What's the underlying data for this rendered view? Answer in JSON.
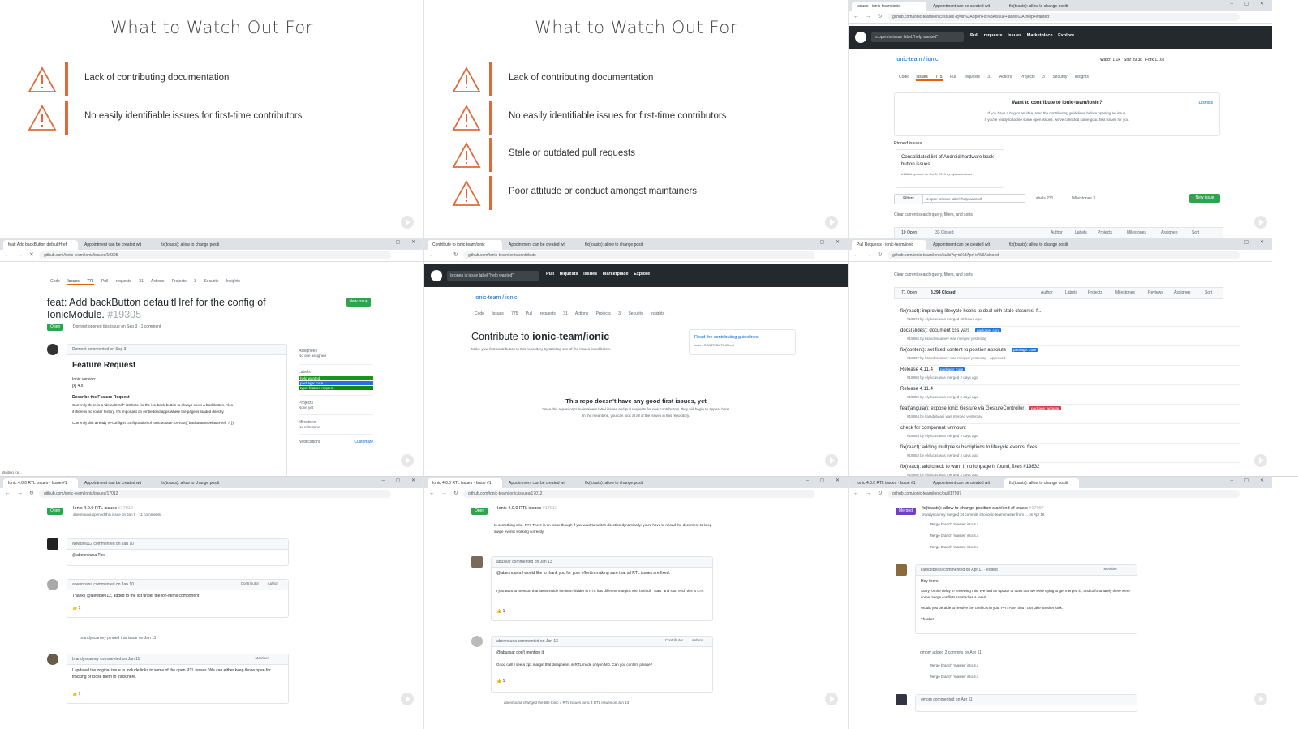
{
  "slides": {
    "title": "What to Watch Out For",
    "items": [
      "Lack of contributing documentation",
      "No easily identifiable issues for first-time contributors",
      "Stale or outdated pull requests",
      "Poor attitude or conduct amongst maintainers"
    ]
  },
  "colors": {
    "accent": "#e0693a",
    "github_dark": "#24292e",
    "green": "#2ea44f",
    "purple": "#6f42c1",
    "blue": "#0366d6"
  },
  "browser": {
    "tabs_a": [
      "Issues · ionic-team/ionic",
      "Appointment can be created wit",
      "fix(toasts): allow to change positi"
    ],
    "tabs_b": [
      "feat: Add backButton defaultHref",
      "Appointment can be created wit",
      "fix(toasts): allow to change positi"
    ],
    "tabs_c": [
      "Contribute to ionic-team/ionic",
      "Appointment can be created wit",
      "fix(toasts): allow to change positi"
    ],
    "tabs_d": [
      "Pull Requests · ionic-team/ionic",
      "Appointment can be created wit",
      "fix(toasts): allow to change positi"
    ],
    "tabs_e": [
      "Ionic 4.0.0 RTL issues · Issue #1",
      "Appointment can be created wit",
      "fix(toasts): allow to change positi"
    ],
    "url_issues": "github.com/ionic-team/ionic/issues?q=is%3Aopen+is%3Aissue+label%3A\"help+wanted\"",
    "url_issue": "github.com/ionic-team/ionic/issues/19305",
    "url_contribute": "github.com/ionic-team/ionic/contribute",
    "url_pulls": "github.com/ionic-team/ionic/pulls?q=is%3Apr+is%3Aclosed",
    "url_rtl": "github.com/ionic-team/ionic/issues/17012",
    "url_pr": "github.com/ionic-team/ionic/pull/17997"
  },
  "github": {
    "search": "is:open is:issue label:\"help wanted\"",
    "nav": [
      "Pull requests",
      "Issues",
      "Marketplace",
      "Explore"
    ],
    "repo": "ionic-team / ionic",
    "repo_tabs": [
      "Code",
      "Issues 775",
      "Pull requests 31",
      "Actions",
      "Projects 3",
      "Security",
      "Insights"
    ],
    "watch": "Watch",
    "watch_count": "1.1k",
    "star": "Star",
    "star_count": "39.3k",
    "fork": "Fork",
    "fork_count": "11.6k"
  },
  "issues_page": {
    "contribute_banner": "Want to contribute to ionic-team/ionic?",
    "contribute_sub": "If you have a bug or an idea, read the contributing guidelines before opening an issue.",
    "contribute_sub2": "If you're ready to tackle some open issues, we've collected some good first issues for you.",
    "dismiss": "Dismiss",
    "pinned_label": "Pinned issues",
    "pinned_title": "Consolidated list of Android hardware back button issues",
    "pinned_meta": "#18611 opened on Oct 6, 2019 by dylanwinstead",
    "filters": "Filters",
    "filter_query": "is:open is:issue label:\"help wanted\"",
    "labels": "Labels 231",
    "milestones": "Milestones 3",
    "new_issue": "New issue",
    "clear": "Clear current search query, filters, and sorts",
    "open_count": "10 Open",
    "closed_count": "33 Closed",
    "sort_cols": [
      "Author",
      "Labels",
      "Projects",
      "Milestones",
      "Assignee",
      "Sort"
    ]
  },
  "issue_page": {
    "title": "feat: Add backButton defaultHref for the config of IonicModule.",
    "number": "#19305",
    "state": "Open",
    "meta": "Domnet opened this issue on Sep 3 · 1 comment",
    "author_line": "Domnet commented on Sep 3",
    "heading": "Feature Request",
    "body1": "Ionic version:",
    "body2": "[x] 4.x",
    "body3": "Describe the Feature Request",
    "body4": "Currently there is a \"defaultHref\" attribute for the ion-back-button to always show a backbutton. Also",
    "body5": "if there is no router history. It's important on embedded apps where the page is loaded directly.",
    "body6": "Currently this already re-config in configuration of IonicModule.forRoot({ backButtonDefaultHref: '/' }).",
    "assignees": "Assignees",
    "no_one": "No one assigned",
    "labels_title": "Labels",
    "label_list": [
      "help wanted",
      "package: core",
      "type: feature request"
    ],
    "projects": "Projects",
    "none_yet": "None yet",
    "milestone": "Milestone",
    "no_milestone": "No milestone",
    "notifications": "Notifications",
    "customize": "Customize",
    "new_issue": "New issue",
    "status": "Waiting for..."
  },
  "contribute_page": {
    "heading_pre": "Contribute to",
    "heading_repo": "ionic-team/ionic",
    "sub": "Make your first contribution to this repository by tackling one of the issues listed below.",
    "guidelines": "Read the contributing guidelines",
    "guidelines_sub": "ionic / CONTRIBUTING.md",
    "empty_title": "This repo doesn't have any good first issues, yet",
    "empty_sub": "Once this repository's maintainers label issues and pull requests for new contributors, they will begin to appear here.",
    "empty_sub2": "In the meantime, you can look at all of the issues in this repository."
  },
  "pulls_page": {
    "clear": "Clear current search query, filters, and sorts",
    "open_count": "71 Open",
    "closed_count": "3,294 Closed",
    "cols": [
      "Author",
      "Labels",
      "Projects",
      "Milestones",
      "Reviews",
      "Assignee",
      "Sort"
    ],
    "rows": [
      {
        "title": "fix(react): improving lifecycle hooks to deal with stale closures. fi...",
        "meta": "#19874 by elylucas was merged 22 hours ago",
        "label": "",
        "label_color": ""
      },
      {
        "title": "docs(slides): document css vars",
        "meta": "#19865 by brandyscarney was merged yesterday",
        "label": "package: core",
        "label_color": "#1d76db"
      },
      {
        "title": "fix(content): set fixed content to position absolute",
        "meta": "#19867 by brandyscarney was merged yesterday · Approved",
        "label": "package: core",
        "label_color": "#1d76db"
      },
      {
        "title": "Release 4.11.4",
        "meta": "#19860 by elylucas was merged 2 days ago",
        "label": "package: core",
        "label_color": "#1d76db"
      },
      {
        "title": "Release 4.11.4",
        "meta": "#19859 by elylucas was merged 2 days ago",
        "label": "",
        "label_color": ""
      },
      {
        "title": "feat(angular): expose Ionic Gesture via GestureController",
        "meta": "#19864 by liamdebeasi was merged yesterday",
        "label": "package: angular",
        "label_color": "#d73a49"
      },
      {
        "title": "check for component unmount",
        "meta": "#19854 by elylucas was merged 2 days ago",
        "label": "",
        "label_color": ""
      },
      {
        "title": "fix(react): adding multiple subscriptions to lifecycle events, fixes ...",
        "meta": "#19853 by elylucas was merged 2 days ago",
        "label": "",
        "label_color": ""
      },
      {
        "title": "fix(react): add check to warn if no ionpage is found, fixes #19832",
        "meta": "#19850 by elylucas was merged 2 days ago",
        "label": "",
        "label_color": ""
      }
    ]
  },
  "rtl_page": {
    "state": "Open",
    "title": "Ionic 4.0.0 RTL issues",
    "number": "#17012",
    "meta": "abennouna opened this issue on Jan 9 · 11 comments",
    "c1_author": "Newbie012 commented on Jan 10",
    "c1_body": "@abennouna Thx",
    "c2_author": "abennouna commented on Jan 10",
    "c2_body": "Thanks @Newbie012, added to the list under the ion-items component",
    "pinned": "brandyscarney pinned this issue on Jan 11",
    "c3_author": "brandyscarney commented on Jan 11",
    "c3_body": "I updated the original issue to include links to some of the open RTL issues. We can either keep those open for tracking or close them to track here.",
    "reaction": "1",
    "member": "Member",
    "contributor": "Contributor",
    "author": "Author"
  },
  "rtl_page2": {
    "top_text": "to something else. FYI: There is an issue though if you want to switch direction dynamically: you'd have to reload the document to keep swipe events working correctly.",
    "c1_author": "abussar commented on Jan 13",
    "c1_body": "@abennouna I would like to thank you for your effort in making sure that all RTL issues are fixed.",
    "c1_body2": "I just want to mention that items inside ion-item-divider in RTL has different margins with both dir \"start\" and slot \"end\" this is LTR",
    "c2_author": "abennouna commented on Jan 13",
    "c2_body": "@abussar don't mention it",
    "c2_body2": "Good call! I see a 2px margin that disappears in RTL mode only in MD. Can you confirm please?",
    "changed": "abennouna changed the title Ionic 4 RTL Issues Ionic 4 RTL issues on Jan 13"
  },
  "pr_page": {
    "state": "Merged",
    "title": "fix(toasts): allow to change position start/end of toasts",
    "number": "#17997",
    "meta": "brandyscarney merged 24 commits into ionic-team:master from ... on Apr 16",
    "commit_msg": "Merge branch 'master' into 4.x",
    "c1_author": "liamdebeasi commented on Apr 11 · edited",
    "c1_hey": "Hey there!",
    "c1_body": "Sorry for the delay in reviewing this. We had an update to toast that we were trying to get merged in, and unfortunately there were some merge conflicts created as a result.",
    "c1_body2": "Would you be able to resolve the conflicts in your PR? After that I can take another look.",
    "c1_thanks": "Thanks!",
    "added": "omom added 2 commits on Apr 11",
    "c2_author": "omom commented on Apr 11",
    "member": "Member"
  }
}
